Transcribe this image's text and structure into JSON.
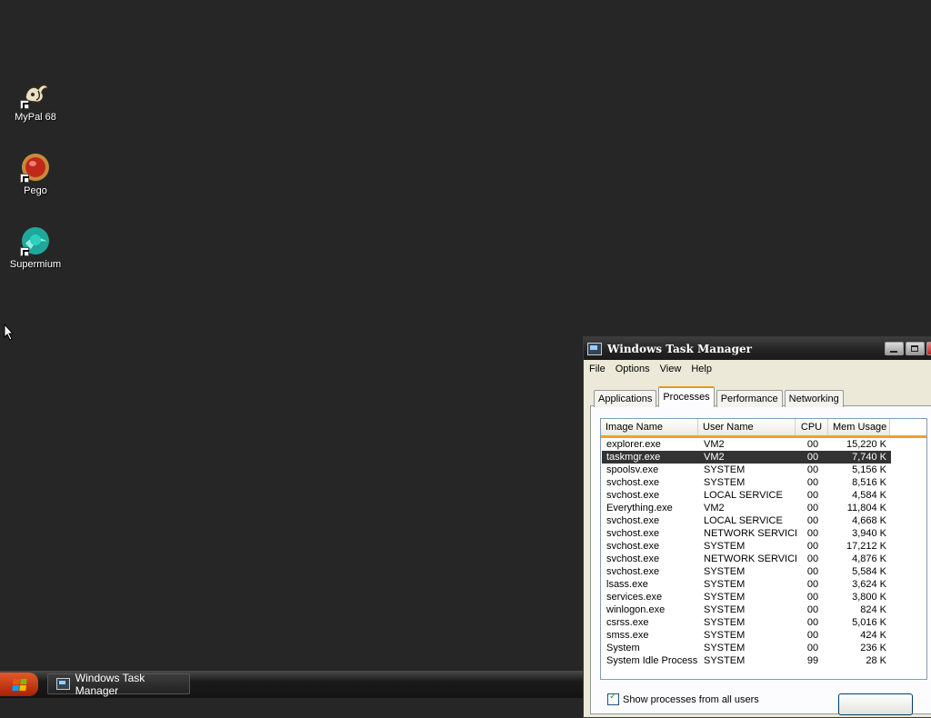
{
  "desktop": {
    "icons": [
      {
        "label": "MyPal 68",
        "icon": "mypal-icon"
      },
      {
        "label": "Pego",
        "icon": "pego-icon"
      },
      {
        "label": "Supermium",
        "icon": "supermium-icon"
      }
    ]
  },
  "task_manager": {
    "title": "Windows Task Manager",
    "menu": [
      "File",
      "Options",
      "View",
      "Help"
    ],
    "tabs": [
      "Applications",
      "Processes",
      "Performance",
      "Networking"
    ],
    "active_tab": "Processes",
    "columns": [
      "Image Name",
      "User Name",
      "CPU",
      "Mem Usage"
    ],
    "processes": [
      {
        "name": "explorer.exe",
        "user": "VM2",
        "cpu": "00",
        "mem": "15,220 K"
      },
      {
        "name": "taskmgr.exe",
        "user": "VM2",
        "cpu": "00",
        "mem": "7,740 K",
        "selected": true
      },
      {
        "name": "spoolsv.exe",
        "user": "SYSTEM",
        "cpu": "00",
        "mem": "5,156 K"
      },
      {
        "name": "svchost.exe",
        "user": "SYSTEM",
        "cpu": "00",
        "mem": "8,516 K"
      },
      {
        "name": "svchost.exe",
        "user": "LOCAL SERVICE",
        "cpu": "00",
        "mem": "4,584 K"
      },
      {
        "name": "Everything.exe",
        "user": "VM2",
        "cpu": "00",
        "mem": "11,804 K"
      },
      {
        "name": "svchost.exe",
        "user": "LOCAL SERVICE",
        "cpu": "00",
        "mem": "4,668 K"
      },
      {
        "name": "svchost.exe",
        "user": "NETWORK SERVICE",
        "cpu": "00",
        "mem": "3,940 K"
      },
      {
        "name": "svchost.exe",
        "user": "SYSTEM",
        "cpu": "00",
        "mem": "17,212 K"
      },
      {
        "name": "svchost.exe",
        "user": "NETWORK SERVICE",
        "cpu": "00",
        "mem": "4,876 K"
      },
      {
        "name": "svchost.exe",
        "user": "SYSTEM",
        "cpu": "00",
        "mem": "5,584 K"
      },
      {
        "name": "lsass.exe",
        "user": "SYSTEM",
        "cpu": "00",
        "mem": "3,624 K"
      },
      {
        "name": "services.exe",
        "user": "SYSTEM",
        "cpu": "00",
        "mem": "3,800 K"
      },
      {
        "name": "winlogon.exe",
        "user": "SYSTEM",
        "cpu": "00",
        "mem": "824 K"
      },
      {
        "name": "csrss.exe",
        "user": "SYSTEM",
        "cpu": "00",
        "mem": "5,016 K"
      },
      {
        "name": "smss.exe",
        "user": "SYSTEM",
        "cpu": "00",
        "mem": "424 K"
      },
      {
        "name": "System",
        "user": "SYSTEM",
        "cpu": "00",
        "mem": "236 K"
      },
      {
        "name": "System Idle Process",
        "user": "SYSTEM",
        "cpu": "99",
        "mem": "28 K"
      }
    ],
    "show_all_label": "Show processes from all users",
    "show_all_checked": true
  },
  "taskbar": {
    "task_label": "Windows Task Manager"
  },
  "colors": {
    "desktop_bg": "#262626",
    "tab_accent": "#e69a1e",
    "selected_row": "#333333",
    "start_button": "#c83c14"
  }
}
